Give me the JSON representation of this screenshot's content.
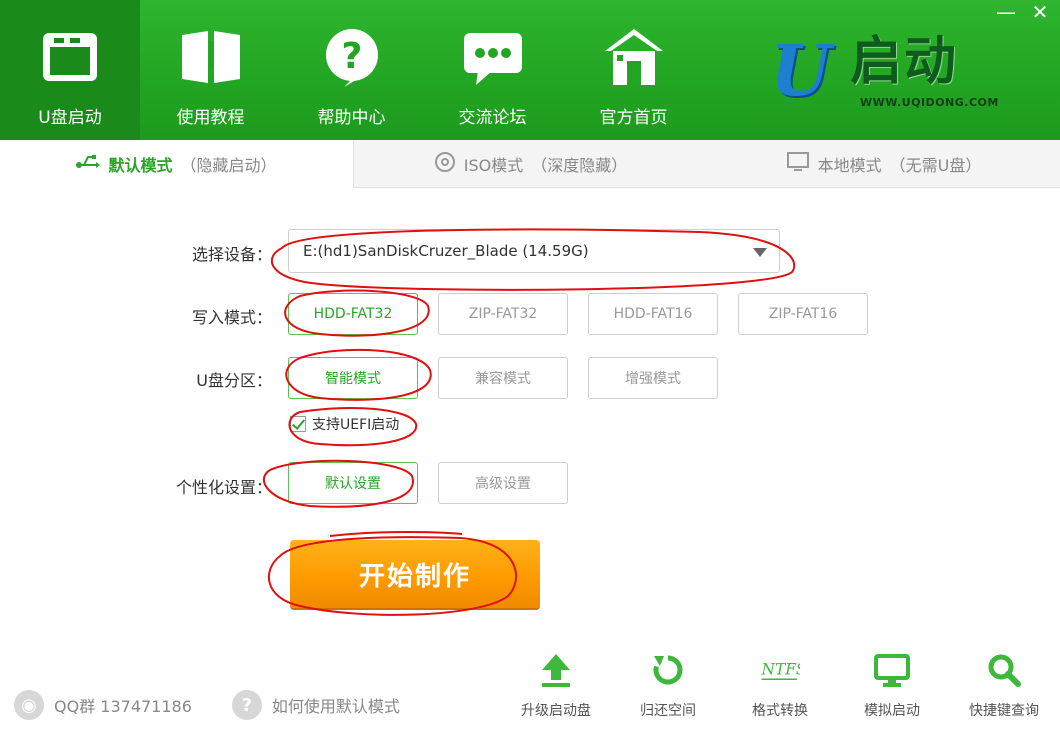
{
  "window": {
    "minimize_glyph": "—",
    "close_glyph": "✕"
  },
  "nav": {
    "items": [
      {
        "label": "U盘启动",
        "icon": "window-icon"
      },
      {
        "label": "使用教程",
        "icon": "book-icon"
      },
      {
        "label": "帮助中心",
        "icon": "question-icon"
      },
      {
        "label": "交流论坛",
        "icon": "chat-bubble-icon"
      },
      {
        "label": "官方首页",
        "icon": "home-icon"
      }
    ]
  },
  "brand": {
    "letter": "U",
    "name": "启动",
    "url": "WWW.UQIDONG.COM"
  },
  "mode_tabs": [
    {
      "label": "默认模式",
      "sub": "（隐藏启动）",
      "icon": "usb-icon"
    },
    {
      "label": "ISO模式",
      "sub": "（深度隐藏）",
      "icon": "disc-icon"
    },
    {
      "label": "本地模式",
      "sub": "（无需U盘）",
      "icon": "monitor-icon"
    }
  ],
  "form": {
    "device_label": "选择设备：",
    "device_value": "E:(hd1)SanDiskCruzer_Blade (14.59G)",
    "write_mode_label": "写入模式：",
    "write_modes": [
      "HDD-FAT32",
      "ZIP-FAT32",
      "HDD-FAT16",
      "ZIP-FAT16"
    ],
    "partition_label": "U盘分区：",
    "partitions": [
      "智能模式",
      "兼容模式",
      "增强模式"
    ],
    "uefi_label": "支持UEFI启动",
    "personal_label": "个性化设置：",
    "personal_options": [
      "默认设置",
      "高级设置"
    ],
    "start_button": "开始制作"
  },
  "footer": {
    "qq_text": "QQ群 137471186",
    "howto_text": "如何使用默认模式",
    "tools": [
      {
        "label": "升级启动盘",
        "icon": "upload-arrow-icon"
      },
      {
        "label": "归还空间",
        "icon": "refresh-icon"
      },
      {
        "label": "格式转换",
        "icon": "ntfs-icon",
        "icon_text": "NTFS"
      },
      {
        "label": "模拟启动",
        "icon": "monitor-icon"
      },
      {
        "label": "快捷键查询",
        "icon": "search-icon"
      }
    ]
  },
  "colors": {
    "header_green": "#22a522",
    "accent_green": "#2aa52a",
    "start_orange": "#ff9a00",
    "annotation_red": "#e01010"
  }
}
